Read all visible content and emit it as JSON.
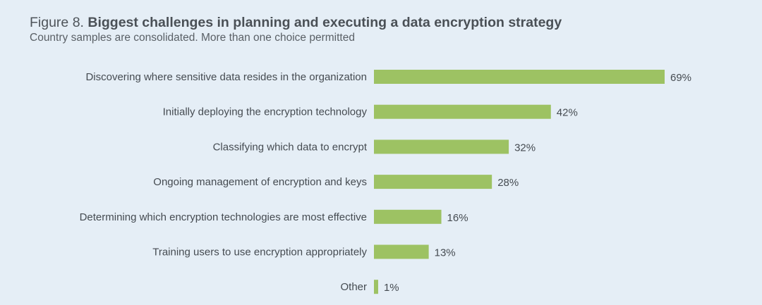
{
  "chart_data": {
    "type": "bar",
    "orientation": "horizontal",
    "title_prefix": "Figure 8.",
    "title": "Biggest challenges in planning and executing a data encryption strategy",
    "subtitle": "Country samples are consolidated. More than one choice permitted",
    "categories": [
      "Discovering where sensitive data resides in the organization",
      "Initially deploying the encryption technology",
      "Classifying which data to encrypt",
      "Ongoing management of encryption and keys",
      "Determining which encryption technologies are most effective",
      "Training users to use encryption appropriately",
      "Other"
    ],
    "values": [
      69,
      42,
      32,
      28,
      16,
      13,
      1
    ],
    "value_labels": [
      "69%",
      "42%",
      "32%",
      "28%",
      "16%",
      "13%",
      "1%"
    ],
    "unit": "%",
    "xlim": [
      0,
      100
    ],
    "grid": false,
    "bar_color": "#9dc263"
  }
}
